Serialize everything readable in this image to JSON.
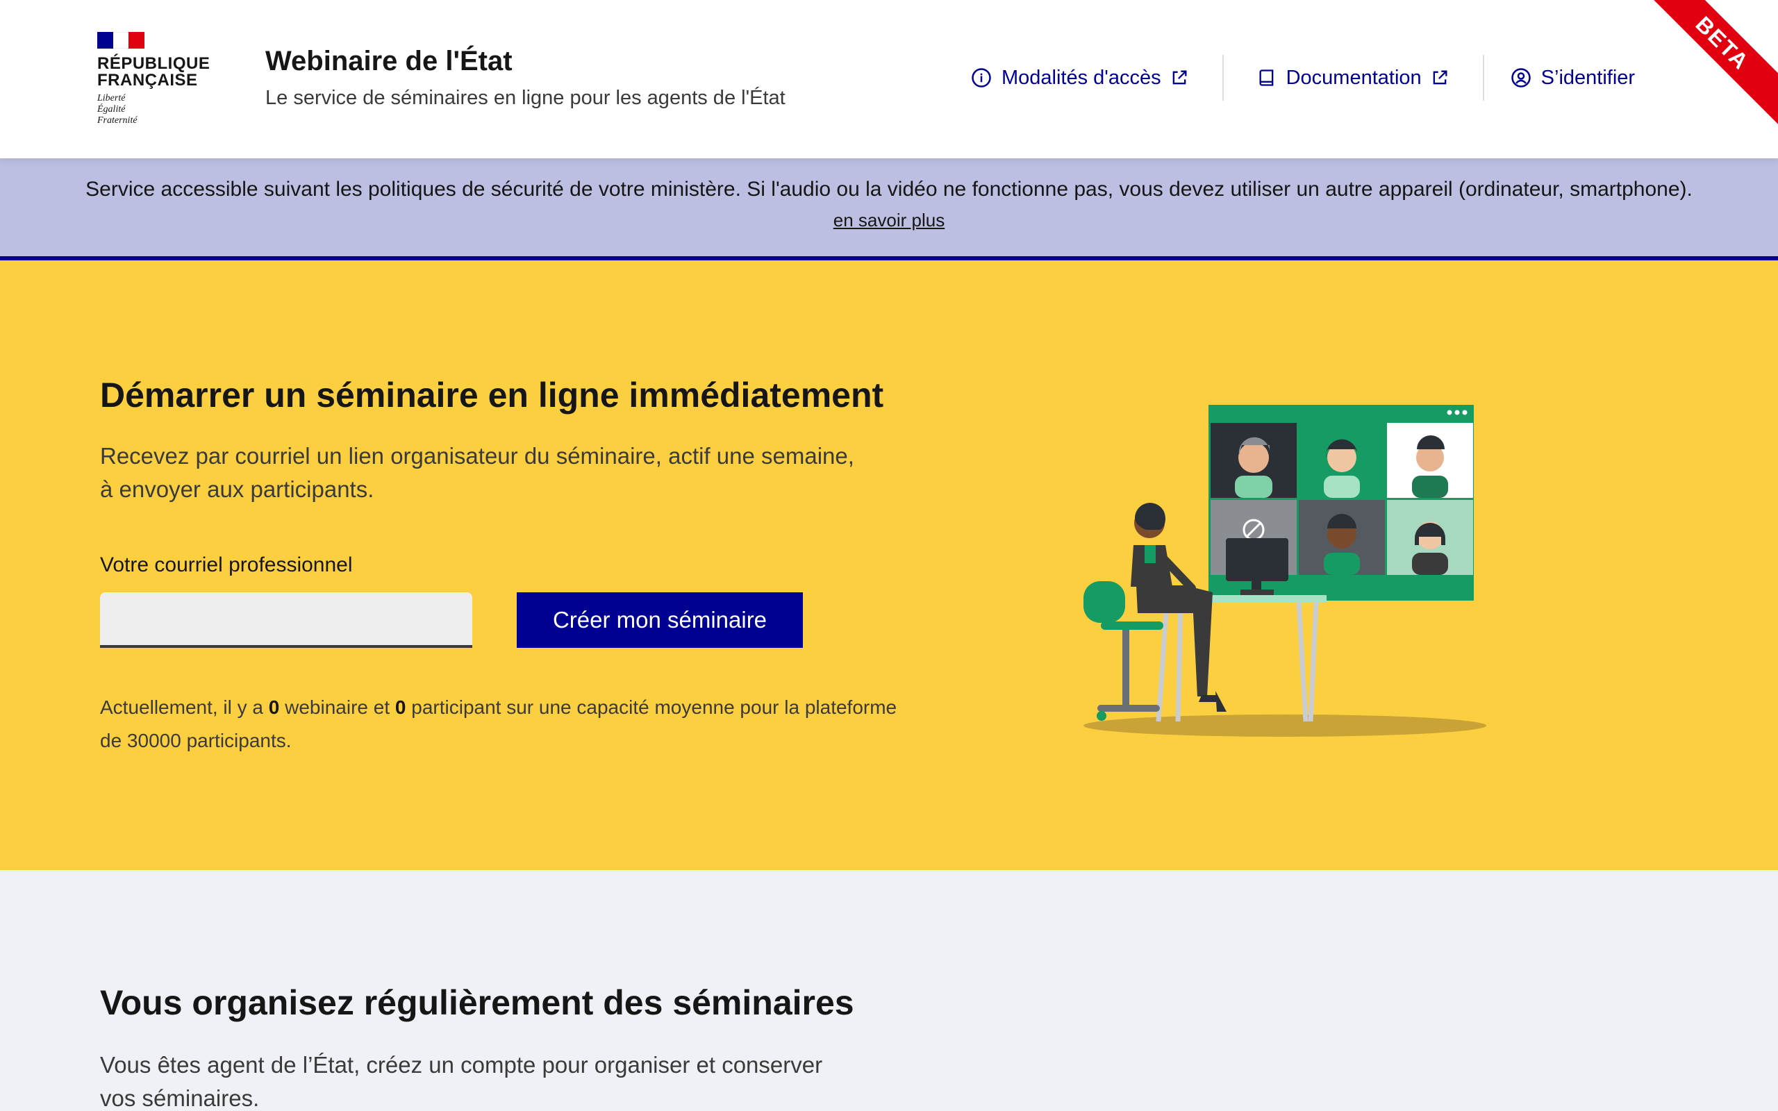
{
  "header": {
    "logo_text": "RÉPUBLIQUE FRANÇAISE",
    "motto_lines": [
      "Liberté",
      "Égalité",
      "Fraternité"
    ],
    "service_title": "Webinaire de l'État",
    "service_tagline": "Le service de séminaires en ligne pour les agents de l'État",
    "nav": {
      "access_label": "Modalités d'accès",
      "docs_label": "Documentation",
      "login_label": "S’identifier"
    },
    "beta_label": "BETA"
  },
  "notice": {
    "text": "Service accessible suivant les politiques de sécurité de votre ministère. Si l'audio ou la vidéo ne fonctionne pas, vous devez utiliser un autre appareil (ordinateur, smartphone).",
    "link": "en savoir plus"
  },
  "hero": {
    "title": "Démarrer un séminaire en ligne immédiatement",
    "description_line1": "Recevez par courriel un lien organisateur du séminaire, actif une semaine,",
    "description_line2": "à envoyer aux participants.",
    "email_label": "Votre courriel professionnel",
    "email_value": "",
    "create_button": "Créer mon séminaire",
    "stats": {
      "prefix": "Actuellement, il y a",
      "webinar_count": "0",
      "webinar_word": "webinaire et",
      "participant_count": "0",
      "suffix": "participant sur une capacité moyenne pour la plateforme de 30000 participants."
    }
  },
  "lower": {
    "title": "Vous organisez régulièrement des séminaires",
    "description_line1": "Vous êtes agent de l’État, créez un compte pour organiser et conserver",
    "description_line2": "vos séminaires."
  },
  "colors": {
    "primary_blue": "#000091",
    "hero_yellow": "#fccf41",
    "notice_lavender": "#bcbee2",
    "beta_red": "#e1000f",
    "illustration_green": "#169b62"
  }
}
